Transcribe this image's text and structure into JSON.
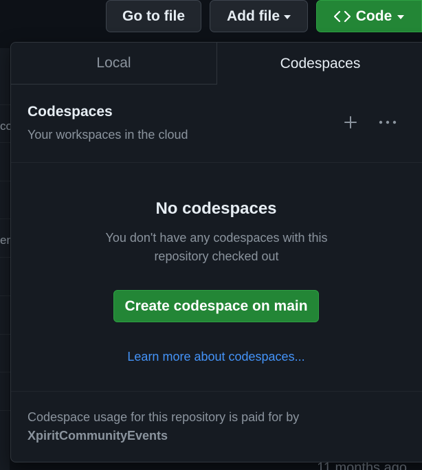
{
  "toolbar": {
    "go_to_file": "Go to file",
    "add_file": "Add file",
    "code": "Code"
  },
  "background": {
    "fragment_1": "co",
    "fragment_2": "en",
    "timestamp": "11 months ago"
  },
  "panel": {
    "tabs": [
      {
        "label": "Local",
        "active": false
      },
      {
        "label": "Codespaces",
        "active": true
      }
    ],
    "header": {
      "title": "Codespaces",
      "subtitle": "Your workspaces in the cloud",
      "add_icon": "plus-icon",
      "more_icon": "kebab-horizontal-icon"
    },
    "empty": {
      "title": "No codespaces",
      "description": "You don't have any codespaces with this repository checked out",
      "create_button": "Create codespace on main",
      "learn_more": "Learn more about codespaces..."
    },
    "footer": {
      "text": "Codespace usage for this repository is paid for by",
      "owner": "XpiritCommunityEvents"
    }
  },
  "colors": {
    "background": "#0d1117",
    "panel": "#161b22",
    "border": "#30363d",
    "primary_green": "#238636",
    "link_blue": "#4493f8",
    "muted_text": "#8b949e"
  }
}
